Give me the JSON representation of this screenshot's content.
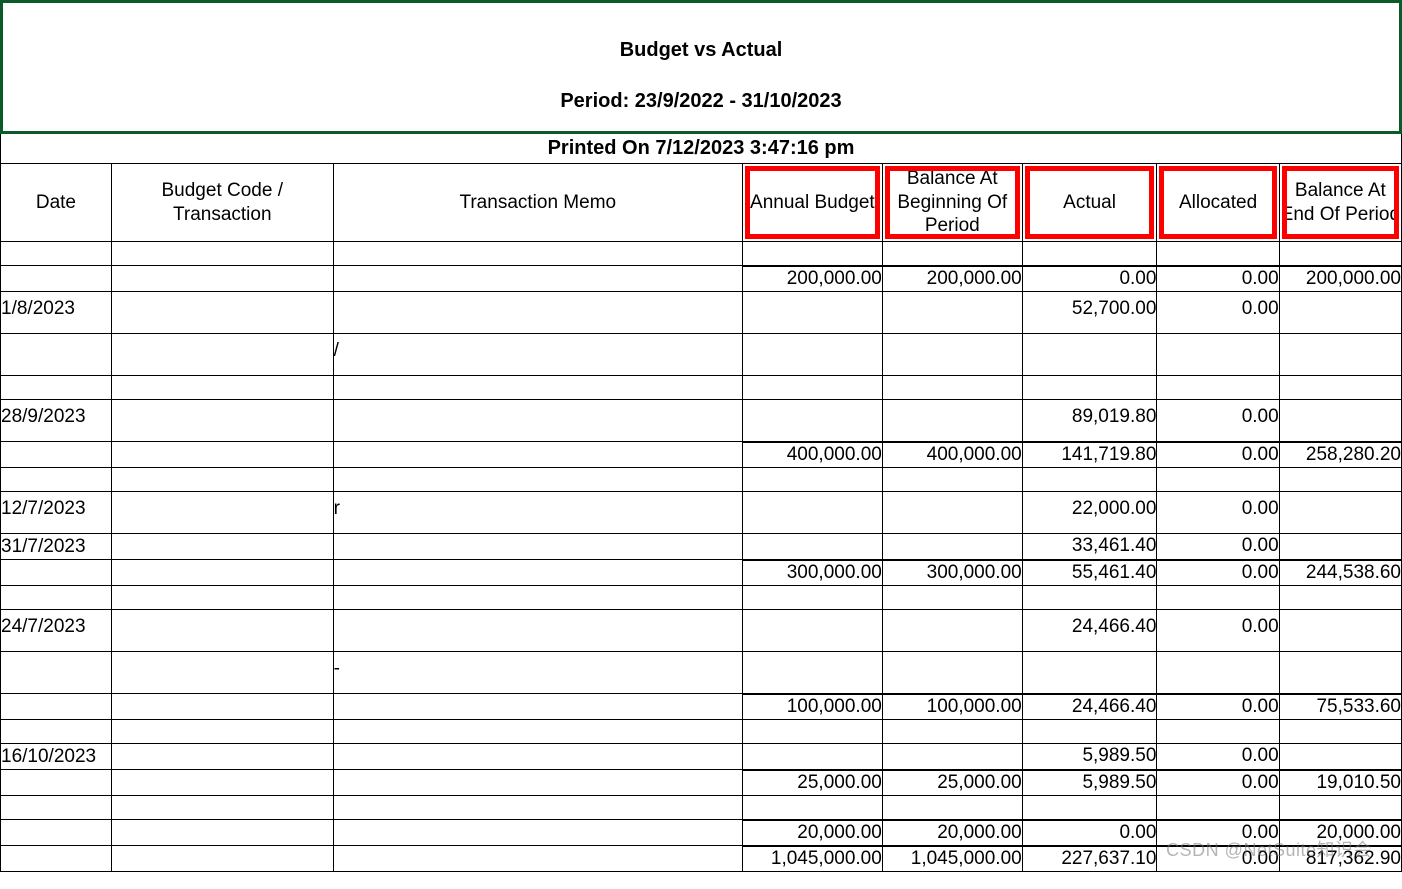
{
  "header": {
    "title": "Budget vs Actual",
    "period_label": "Period: 23/9/2022 - 31/10/2023",
    "printed": "Printed On 7/12/2023 3:47:16 pm"
  },
  "columns": {
    "date": "Date",
    "code": "Budget Code / Transaction",
    "memo": "Transaction Memo",
    "annual": "Annual Budget",
    "bob": "Balance At Beginning Of Period",
    "actual": "Actual",
    "alloc": "Allocated",
    "eob": "Balance At End Of Period"
  },
  "rows": [
    {
      "date": "",
      "memo": "",
      "annual": "",
      "bob": "",
      "actual": "",
      "alloc": "",
      "eob": "",
      "cls": "thin"
    },
    {
      "date": "",
      "memo": "",
      "annual": "200,000.00",
      "bob": "200,000.00",
      "actual": "0.00",
      "alloc": "0.00",
      "eob": "200,000.00",
      "sum": true
    },
    {
      "date": "1/8/2023",
      "memo": "",
      "annual": "",
      "bob": "",
      "actual": "52,700.00",
      "alloc": "0.00",
      "eob": "",
      "cls": "tall"
    },
    {
      "date": "",
      "memo": "/",
      "annual": "",
      "bob": "",
      "actual": "",
      "alloc": "",
      "eob": "",
      "cls": "tall"
    },
    {
      "date": "",
      "memo": "",
      "annual": "",
      "bob": "",
      "actual": "",
      "alloc": "",
      "eob": "",
      "cls": "thin"
    },
    {
      "date": "28/9/2023",
      "memo": "",
      "annual": "",
      "bob": "",
      "actual": "89,019.80",
      "alloc": "0.00",
      "eob": "",
      "cls": "tall"
    },
    {
      "date": "",
      "memo": "",
      "annual": "400,000.00",
      "bob": "400,000.00",
      "actual": "141,719.80",
      "alloc": "0.00",
      "eob": "258,280.20",
      "sum": true
    },
    {
      "date": "",
      "memo": "",
      "annual": "",
      "bob": "",
      "actual": "",
      "alloc": "",
      "eob": "",
      "cls": "thin"
    },
    {
      "date": "12/7/2023",
      "memo": "r",
      "annual": "",
      "bob": "",
      "actual": "22,000.00",
      "alloc": "0.00",
      "eob": "",
      "cls": "tall"
    },
    {
      "date": "31/7/2023",
      "memo": "",
      "annual": "",
      "bob": "",
      "actual": "33,461.40",
      "alloc": "0.00",
      "eob": ""
    },
    {
      "date": "",
      "memo": "",
      "annual": "300,000.00",
      "bob": "300,000.00",
      "actual": "55,461.40",
      "alloc": "0.00",
      "eob": "244,538.60",
      "sum": true
    },
    {
      "date": "",
      "memo": "",
      "annual": "",
      "bob": "",
      "actual": "",
      "alloc": "",
      "eob": "",
      "cls": "thin"
    },
    {
      "date": "24/7/2023",
      "memo": "",
      "annual": "",
      "bob": "",
      "actual": "24,466.40",
      "alloc": "0.00",
      "eob": "",
      "cls": "tall"
    },
    {
      "date": "",
      "memo": "-",
      "annual": "",
      "bob": "",
      "actual": "",
      "alloc": "",
      "eob": "",
      "cls": "tall"
    },
    {
      "date": "",
      "memo": "",
      "annual": "100,000.00",
      "bob": "100,000.00",
      "actual": "24,466.40",
      "alloc": "0.00",
      "eob": "75,533.60",
      "sum": true
    },
    {
      "date": "",
      "memo": "",
      "annual": "",
      "bob": "",
      "actual": "",
      "alloc": "",
      "eob": "",
      "cls": "thin"
    },
    {
      "date": "16/10/2023",
      "memo": "",
      "annual": "",
      "bob": "",
      "actual": "5,989.50",
      "alloc": "0.00",
      "eob": ""
    },
    {
      "date": "",
      "memo": "",
      "annual": "25,000.00",
      "bob": "25,000.00",
      "actual": "5,989.50",
      "alloc": "0.00",
      "eob": "19,010.50",
      "sum": true
    },
    {
      "date": "",
      "memo": "",
      "annual": "",
      "bob": "",
      "actual": "",
      "alloc": "",
      "eob": "",
      "cls": "thin"
    },
    {
      "date": "",
      "memo": "",
      "annual": "20,000.00",
      "bob": "20,000.00",
      "actual": "0.00",
      "alloc": "0.00",
      "eob": "20,000.00",
      "sum": true
    },
    {
      "date": "",
      "memo": "",
      "annual": "1,045,000.00",
      "bob": "1,045,000.00",
      "actual": "227,637.10",
      "alloc": "0.00",
      "eob": "817,362.90",
      "grand": true
    }
  ],
  "watermark": "CSDN @NetSuite知识会"
}
